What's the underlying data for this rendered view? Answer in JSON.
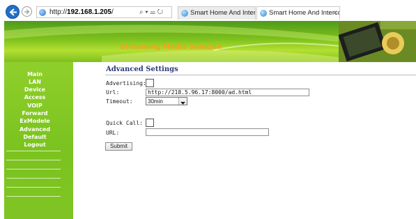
{
  "browser": {
    "address_prefix": "http://",
    "address_host": "192.168.1.205",
    "address_suffix": "/",
    "address_tools": "⌕ ▾ ☰ ↻",
    "tabs": [
      {
        "label": "Smart Home And Intercom Sys...",
        "active": false
      },
      {
        "label": "Smart Home And Intercom ...",
        "active": true,
        "close": "×"
      }
    ]
  },
  "banner": {
    "title": "Streaming Media Solution"
  },
  "sidebar": {
    "items": [
      {
        "label": "Main"
      },
      {
        "label": "LAN"
      },
      {
        "label": "Device"
      },
      {
        "label": "Access"
      },
      {
        "label": "VOIP"
      },
      {
        "label": "Forward"
      },
      {
        "label": "ExModele"
      },
      {
        "label": "Advanced"
      },
      {
        "label": "Default"
      },
      {
        "label": "Logout"
      }
    ]
  },
  "form": {
    "title": "Advanced Settings",
    "advertising_label": "Advertising:",
    "advertising_checked": false,
    "url_label": "Url:",
    "url_value": "http://218.5.96.17:8000/ad.html",
    "timeout_label": "Timeout:",
    "timeout_value": "30min",
    "quick_call_label": "Quick Call:",
    "quick_call_checked": false,
    "quick_url_label": "URL:",
    "quick_url_value": "",
    "submit_label": "Submit"
  },
  "colors": {
    "sidebar_green": "#7bc31f",
    "banner_title_orange": "#f2a21c",
    "title_navy": "#2b3b77"
  }
}
